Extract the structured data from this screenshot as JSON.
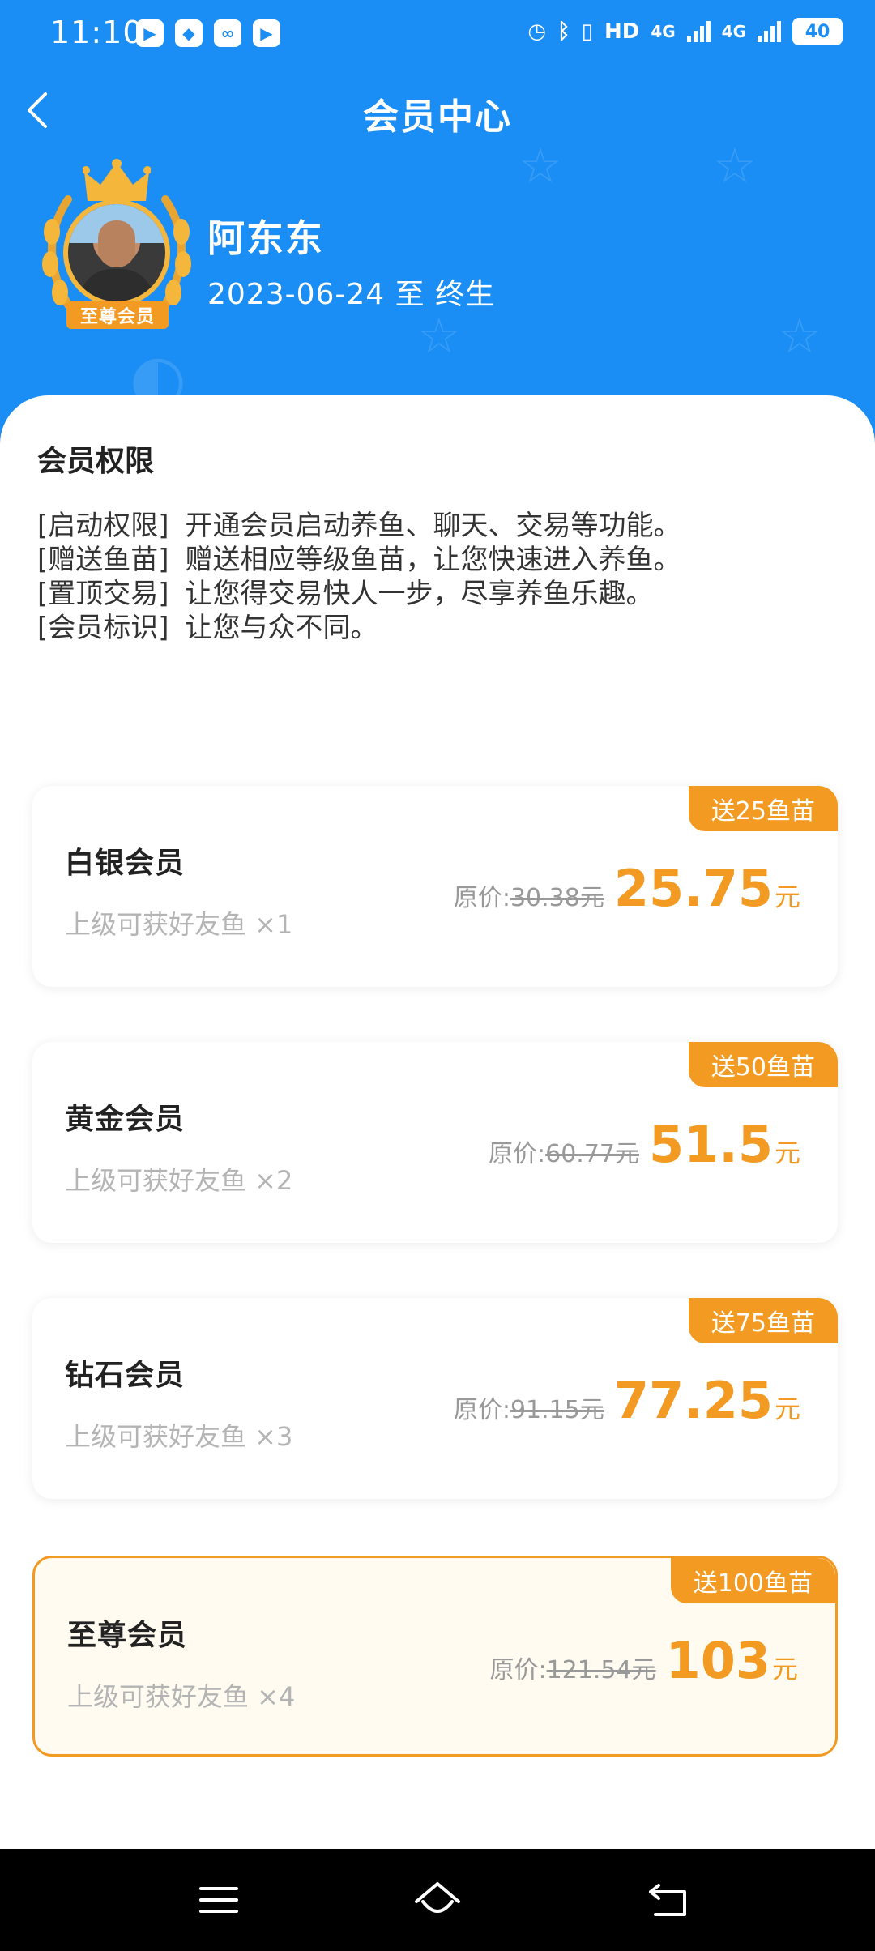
{
  "status_bar": {
    "time": "11:10",
    "network_1": "4G",
    "network_2": "4G",
    "hd_label": "HD",
    "battery": "40"
  },
  "header": {
    "title": "会员中心"
  },
  "user": {
    "name": "阿东东",
    "validity": "2023-06-24 至 终生",
    "badge": "至尊会员"
  },
  "permissions": {
    "title": "会员权限",
    "items": [
      {
        "tag": "[启动权限]",
        "text": "开通会员启动养鱼、聊天、交易等功能。"
      },
      {
        "tag": "[赠送鱼苗]",
        "text": "赠送相应等级鱼苗，让您快速进入养鱼。"
      },
      {
        "tag": "[置顶交易]",
        "text": "让您得交易快人一步，尽享养鱼乐趣。"
      },
      {
        "tag": "[会员标识]",
        "text": "让您与众不同。"
      }
    ]
  },
  "plans": [
    {
      "name": "白银会员",
      "gift": "送25鱼苗",
      "reward": "上级可获好友鱼 ×1",
      "orig_label": "原价:",
      "orig_price": "30.38元",
      "price": "25.75",
      "unit": "元",
      "selected": false
    },
    {
      "name": "黄金会员",
      "gift": "送50鱼苗",
      "reward": "上级可获好友鱼 ×2",
      "orig_label": "原价:",
      "orig_price": "60.77元",
      "price": "51.5",
      "unit": "元",
      "selected": false
    },
    {
      "name": "钻石会员",
      "gift": "送75鱼苗",
      "reward": "上级可获好友鱼 ×3",
      "orig_label": "原价:",
      "orig_price": "91.15元",
      "price": "77.25",
      "unit": "元",
      "selected": false
    },
    {
      "name": "至尊会员",
      "gift": "送100鱼苗",
      "reward": "上级可获好友鱼 ×4",
      "orig_label": "原价:",
      "orig_price": "121.54元",
      "price": "103",
      "unit": "元",
      "selected": true
    }
  ],
  "colors": {
    "header_blue": "#1a8ef5",
    "accent_orange": "#f39a22",
    "selected_bg": "#fffbf1"
  },
  "icons": {
    "back": "chevron-left-icon",
    "menu": "menu-icon",
    "home": "home-icon",
    "return": "return-icon"
  }
}
